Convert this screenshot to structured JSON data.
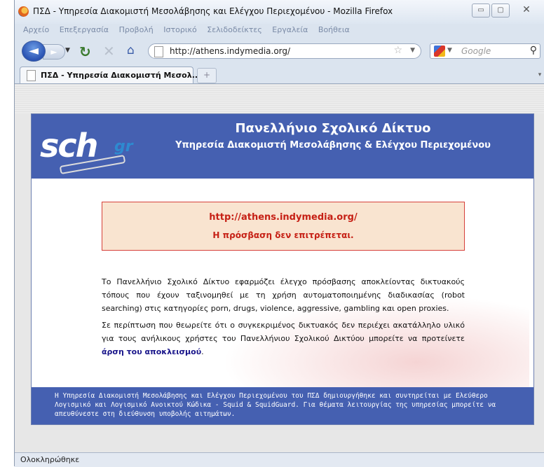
{
  "window": {
    "title": "ΠΣΔ - Υπηρεσία Διακομιστή Μεσολάβησης και Ελέγχου Περιεχομένου - Mozilla Firefox",
    "minimize": "▭",
    "maximize": "▢",
    "close": "✕"
  },
  "menu": [
    "Αρχείο",
    "Επεξεργασία",
    "Προβολή",
    "Ιστορικό",
    "Σελιδοδείκτες",
    "Εργαλεία",
    "Βοήθεια"
  ],
  "nav": {
    "url": "http://athens.indymedia.org/",
    "search_placeholder": "Google"
  },
  "tabs": [
    {
      "label": "ΠΣΔ - Υπηρεσία Διακομιστή Μεσολ..."
    }
  ],
  "page": {
    "logo_text": "sch",
    "logo_suffix": "gr",
    "header_title": "Πανελλήνιο Σχολικό Δίκτυο",
    "header_subtitle": "Υπηρεσία Διακομιστή Μεσολάβησης & Ελέγχου Περιεχομένου",
    "blocked_url": "http://athens.indymedia.org/",
    "blocked_message": "Η πρόσβαση δεν επιτρέπεται.",
    "paragraph1": "Το Πανελλήνιο Σχολικό Δίκτυο εφαρμόζει έλεγχο πρόσβασης αποκλείοντας δικτυακούς τόπους που έχουν ταξινομηθεί με τη χρήση αυτοματοποιημένης διαδικασίας (robot searching) στις κατηγορίες porn, drugs, violence, aggressive, gambling και open proxies.",
    "paragraph2": "Σε περίπτωση που θεωρείτε ότι ο συγκεκριμένος δικτυακός δεν περιέχει ακατάλληλο υλικό για τους ανήλικους χρήστες του Πανελλήνιου Σχολικού Δικτύου μπορείτε να προτείνετε",
    "unblock_link": "άρση του αποκλεισμού",
    "paragraph2_end": ".",
    "footer": "Η Υπηρεσία Διακομιστή Μεσολάβησης και Ελέγχου Περιεχομένου του ΠΣΔ δημιουργήθηκε και συντηρείται με Ελεύθερο Λογισμικό και Λογισμικό Ανοικτού Κώδικα - Squid & SquidGuard. Για θέματα λειτουργίας της υπηρεσίας μπορείτε να απευθύνεστε στη διεύθυνση υποβολής αιτημάτων."
  },
  "status": "Ολοκληρώθηκε",
  "colors": {
    "header_blue": "#4560b1",
    "alert_red": "#c62015",
    "alert_bg": "#f9e4d0"
  }
}
